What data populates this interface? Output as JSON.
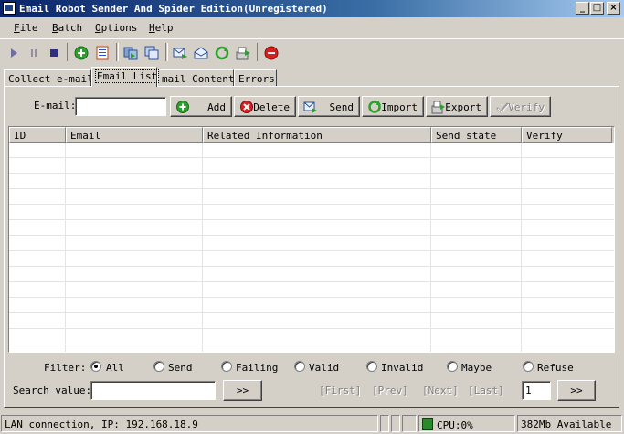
{
  "window": {
    "title": "Email Robot Sender And Spider Edition(Unregistered)",
    "controls": {
      "minimize": "_",
      "maximize": "□",
      "close": "×"
    }
  },
  "menu": [
    {
      "pre": "",
      "ul": "F",
      "post": "ile"
    },
    {
      "pre": "",
      "ul": "B",
      "post": "atch"
    },
    {
      "pre": "",
      "ul": "O",
      "post": "ptions"
    },
    {
      "pre": "",
      "ul": "H",
      "post": "elp"
    }
  ],
  "toolbar_icons": [
    "play-icon",
    "pause-icon",
    "stop-icon",
    "add-circle-icon",
    "list-icon",
    "copy-icon",
    "duplicate-icon",
    "mail-send-icon",
    "mail-open-icon",
    "refresh-icon",
    "export-icon",
    "stop-sign-icon"
  ],
  "tabs": [
    "Collect e-mail",
    "Email List",
    "mail Content",
    "Errors"
  ],
  "email_form": {
    "label": "E-mail:",
    "value": "",
    "buttons": {
      "add": "Add",
      "delete": "Delete",
      "send": "Send",
      "import": "Import",
      "export": "Export",
      "verify": "Verify"
    }
  },
  "grid": {
    "columns": [
      "ID",
      "Email",
      "Related Information",
      "Send  state",
      "Verify"
    ],
    "rows": []
  },
  "filter": {
    "label": "Filter:",
    "options": [
      "All",
      "Send",
      "Failing",
      "Valid",
      "Invalid",
      "Maybe",
      "Refuse"
    ],
    "selected": "All"
  },
  "search": {
    "label": "Search value:",
    "value": "",
    "go": ">>"
  },
  "pager": {
    "first": "[First]",
    "prev": "[Prev]",
    "next": "[Next]",
    "last": "[Last]",
    "page": "1",
    "go": ">>"
  },
  "status": {
    "connection": "LAN connection, IP: 192.168.18.9",
    "cpu": "CPU:0%",
    "memory": "382Mb Available"
  },
  "colors": {
    "titlebar_start": "#0a246a",
    "titlebar_end": "#a6caf0",
    "face": "#d4d0c8",
    "green": "#2e9e2e",
    "red": "#d42020"
  }
}
